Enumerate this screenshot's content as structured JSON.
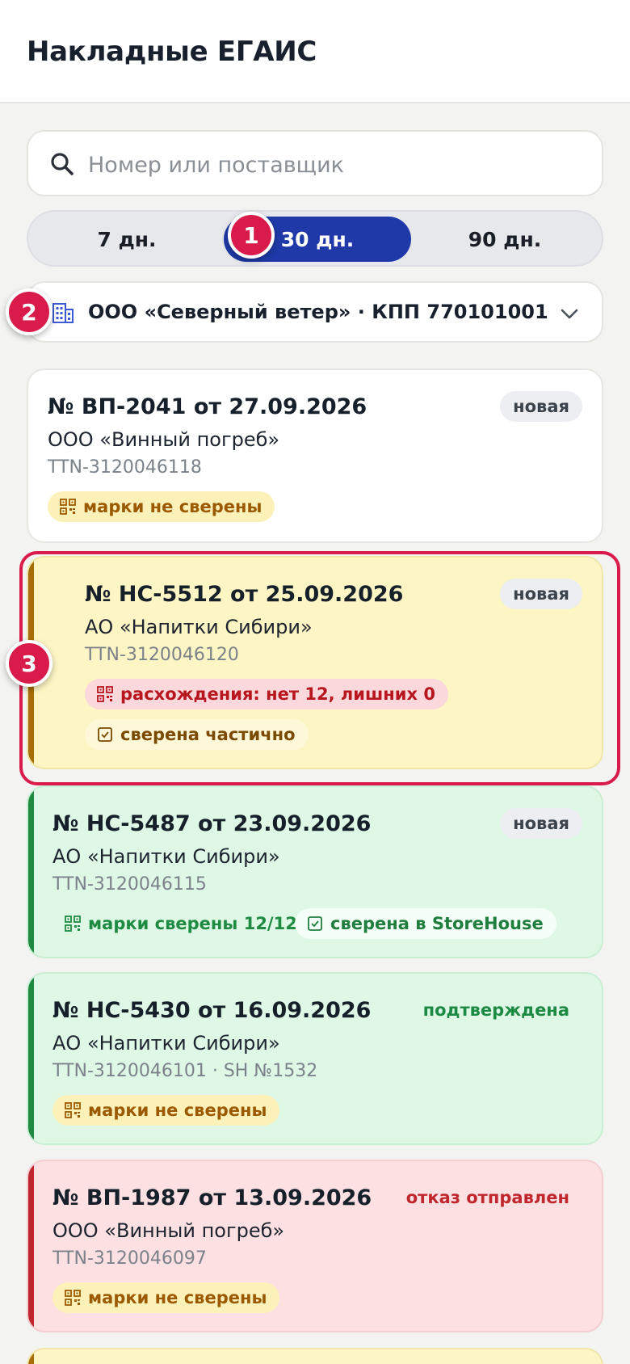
{
  "header": {
    "title": "Накладные ЕГАИС"
  },
  "search": {
    "placeholder": "Номер или поставщик"
  },
  "period": {
    "options": [
      "7 дн.",
      "30 дн.",
      "90 дн."
    ],
    "selected": "30 дн."
  },
  "organization": {
    "label": "ООО «Северный ветер» · КПП 770101001"
  },
  "invoices": [
    {
      "number": "№ ВП-2041 от 27.09.2026",
      "supplier": "ООО «Винный погреб»",
      "ttn": "TTN-3120046118",
      "status": "новая",
      "chips": [
        "марки не сверены"
      ]
    },
    {
      "number": "№ НС-5512 от 25.09.2026",
      "supplier": "АО «Напитки Сибири»",
      "ttn": "TTN-3120046120",
      "status": "новая",
      "chips": [
        "расхождения: нет 12, лишних 0",
        "сверена частично"
      ]
    },
    {
      "number": "№ НС-5487 от 23.09.2026",
      "supplier": "АО «Напитки Сибири»",
      "ttn": "TTN-3120046115",
      "status": "новая",
      "chips": [
        "марки сверены 12/12",
        "сверена в StoreHouse"
      ]
    },
    {
      "number": "№ НС-5430 от 16.09.2026",
      "supplier": "АО «Напитки Сибири»",
      "ttn": "TTN-3120046101 · SH №1532",
      "status": "подтверждена",
      "chips": [
        "марки не сверены"
      ]
    },
    {
      "number": "№ ВП-1987 от 13.09.2026",
      "supplier": "ООО «Винный погреб»",
      "ttn": "TTN-3120046097",
      "status": "отказ отправлен",
      "chips": [
        "марки не сверены"
      ]
    }
  ],
  "annotations": [
    "1",
    "2",
    "3"
  ],
  "colors": {
    "accent": "#1f3aa8",
    "highlight": "#d81b4a",
    "card_partial": "#fdf5c4",
    "card_ok": "#def8e5",
    "card_rejected": "#fce0e2"
  },
  "icons": [
    "search-icon",
    "building-icon",
    "chevron-down-icon",
    "qr-icon",
    "checkbox-icon"
  ]
}
